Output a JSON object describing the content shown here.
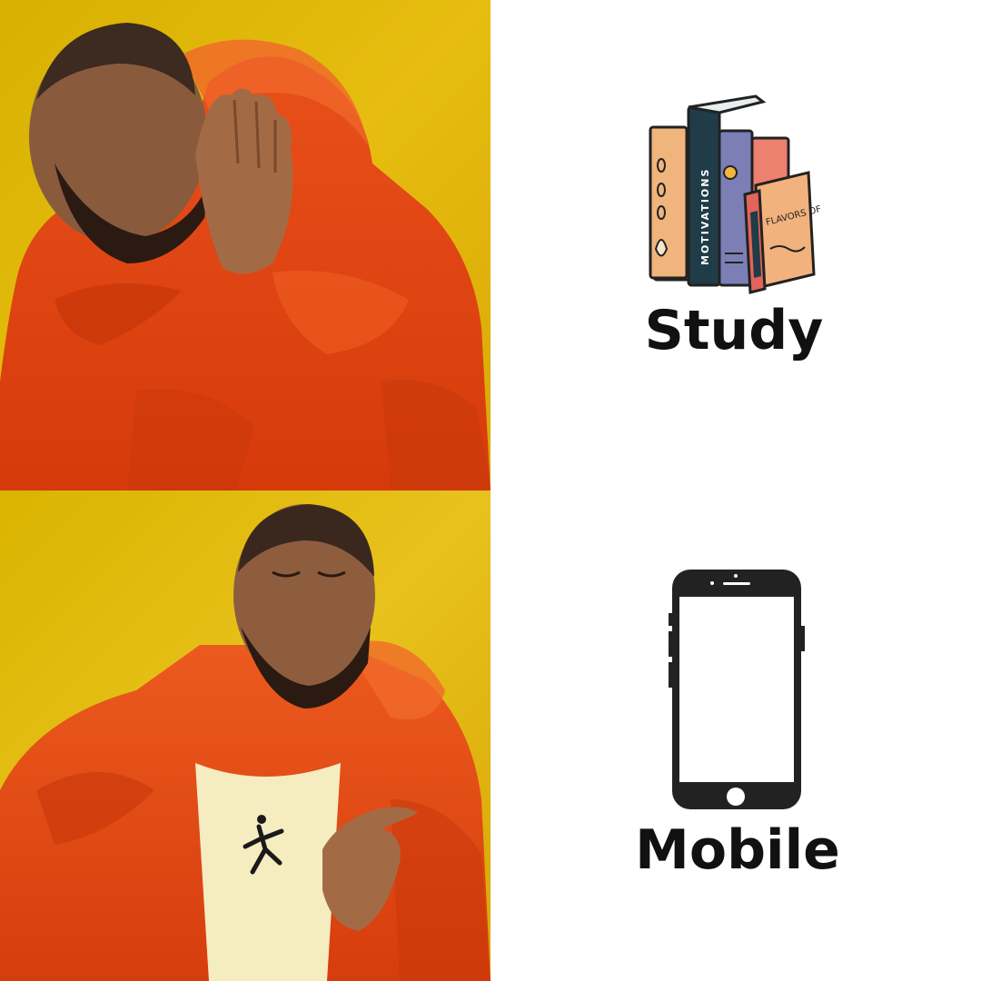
{
  "panels": [
    {
      "caption": "Study",
      "illustration": "books-icon",
      "book_titles": [
        "MOTIVATIONS",
        "FLAVORS OF YOGURT"
      ]
    },
    {
      "caption": "Mobile",
      "illustration": "smartphone-icon"
    }
  ],
  "colors": {
    "background_yellow": "#e3b50a",
    "jacket_orange": "#e0440f",
    "text": "#111111",
    "panel_right": "#ffffff"
  }
}
